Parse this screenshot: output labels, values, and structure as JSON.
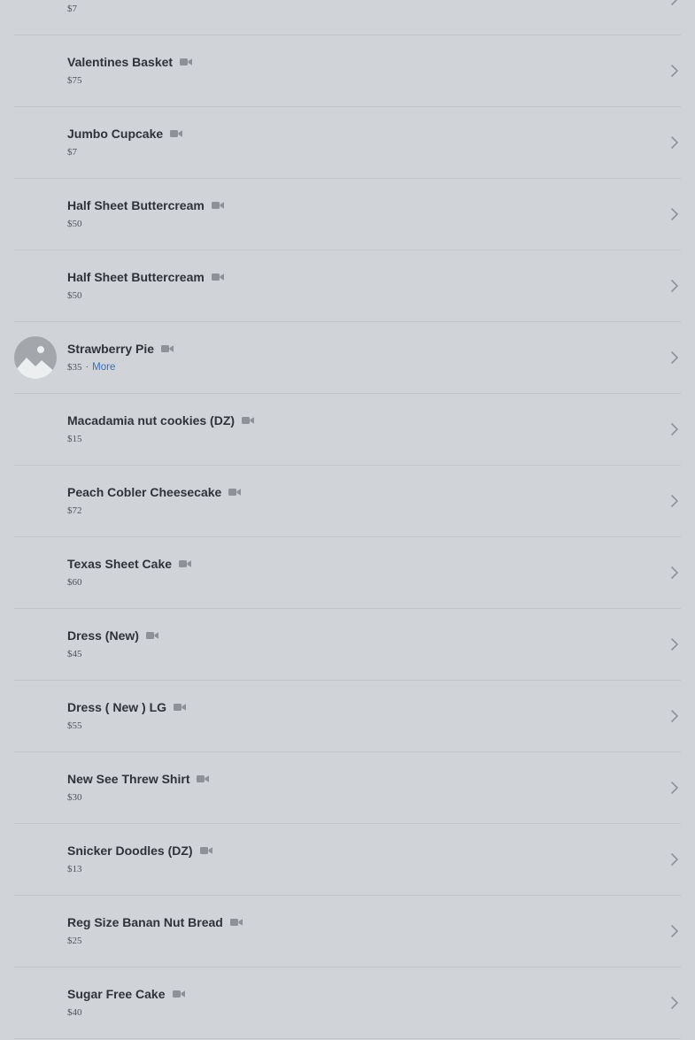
{
  "colors": {
    "background": "#d0d4d8",
    "title_text": "#2f3238",
    "price_text": "#4f535a",
    "link": "#3a6fb8",
    "icon": "#8e9298",
    "placeholder_bg": "#a3a7ac",
    "divider": "#c2c6cb"
  },
  "icons": {
    "video": "video-camera-icon",
    "chevron": "chevron-right-icon",
    "placeholder": "image-placeholder-icon"
  },
  "items": [
    {
      "name": "",
      "price": "$7",
      "has_thumb": false,
      "more": ""
    },
    {
      "name": "Valentines Basket",
      "price": "$75",
      "has_thumb": false,
      "more": ""
    },
    {
      "name": "Jumbo Cupcake",
      "price": "$7",
      "has_thumb": false,
      "more": ""
    },
    {
      "name": "Half Sheet Buttercream",
      "price": "$50",
      "has_thumb": false,
      "more": ""
    },
    {
      "name": "Half Sheet Buttercream",
      "price": "$50",
      "has_thumb": false,
      "more": ""
    },
    {
      "name": "Strawberry Pie",
      "price": "$35",
      "has_thumb": true,
      "more": "More"
    },
    {
      "name": "Macadamia nut cookies (DZ)",
      "price": "$15",
      "has_thumb": false,
      "more": ""
    },
    {
      "name": "Peach Cobler Cheesecake",
      "price": "$72",
      "has_thumb": false,
      "more": ""
    },
    {
      "name": "Texas Sheet Cake",
      "price": "$60",
      "has_thumb": false,
      "more": ""
    },
    {
      "name": "Dress (New)",
      "price": "$45",
      "has_thumb": false,
      "more": ""
    },
    {
      "name": "Dress ( New ) LG",
      "price": "$55",
      "has_thumb": false,
      "more": ""
    },
    {
      "name": "New See Threw Shirt",
      "price": "$30",
      "has_thumb": false,
      "more": ""
    },
    {
      "name": "Snicker Doodles (DZ)",
      "price": "$13",
      "has_thumb": false,
      "more": ""
    },
    {
      "name": "Reg Size Banan Nut Bread",
      "price": "$25",
      "has_thumb": false,
      "more": ""
    },
    {
      "name": "Sugar Free Cake",
      "price": "$40",
      "has_thumb": false,
      "more": ""
    }
  ]
}
